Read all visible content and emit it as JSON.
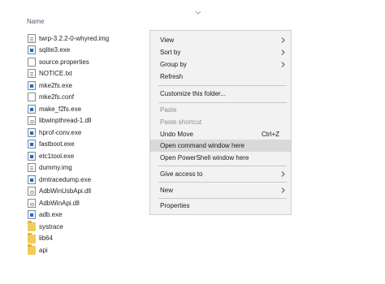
{
  "header": {
    "column_name": "Name"
  },
  "files": [
    {
      "name": "twrp-3.2.2-0-whyred.img",
      "icon": "file-icon",
      "type": "doc"
    },
    {
      "name": "sqlite3.exe",
      "icon": "exe-icon",
      "type": "exe"
    },
    {
      "name": "source.properties",
      "icon": "file-icon",
      "type": "blank"
    },
    {
      "name": "NOTICE.txt",
      "icon": "text-file-icon",
      "type": "doc"
    },
    {
      "name": "mke2fs.exe",
      "icon": "exe-icon",
      "type": "exe"
    },
    {
      "name": "mke2fs.conf",
      "icon": "file-icon",
      "type": "blank"
    },
    {
      "name": "make_f2fs.exe",
      "icon": "exe-icon",
      "type": "exe"
    },
    {
      "name": "libwinpthread-1.dll",
      "icon": "dll-icon",
      "type": "dll"
    },
    {
      "name": "hprof-conv.exe",
      "icon": "exe-icon",
      "type": "exe"
    },
    {
      "name": "fastboot.exe",
      "icon": "exe-icon",
      "type": "exe"
    },
    {
      "name": "etc1tool.exe",
      "icon": "exe-icon",
      "type": "exe"
    },
    {
      "name": "dummy.img",
      "icon": "file-icon",
      "type": "doc"
    },
    {
      "name": "dmtracedump.exe",
      "icon": "exe-icon",
      "type": "exe"
    },
    {
      "name": "AdbWinUsbApi.dll",
      "icon": "dll-icon",
      "type": "dll"
    },
    {
      "name": "AdbWinApi.dll",
      "icon": "dll-icon",
      "type": "dll"
    },
    {
      "name": "adb.exe",
      "icon": "exe-icon",
      "type": "exe"
    },
    {
      "name": "systrace",
      "icon": "folder-icon",
      "type": "folder"
    },
    {
      "name": "lib64",
      "icon": "folder-icon",
      "type": "folder"
    },
    {
      "name": "api",
      "icon": "folder-icon",
      "type": "folder"
    }
  ],
  "context_menu": {
    "view": "View",
    "sort_by": "Sort by",
    "group_by": "Group by",
    "refresh": "Refresh",
    "customize": "Customize this folder...",
    "paste": "Paste",
    "paste_shortcut": "Paste shortcut",
    "undo_move": "Undo Move",
    "undo_shortcut": "Ctrl+Z",
    "open_cmd": "Open command window here",
    "open_powershell": "Open PowerShell window here",
    "give_access": "Give access to",
    "new": "New",
    "properties": "Properties"
  }
}
